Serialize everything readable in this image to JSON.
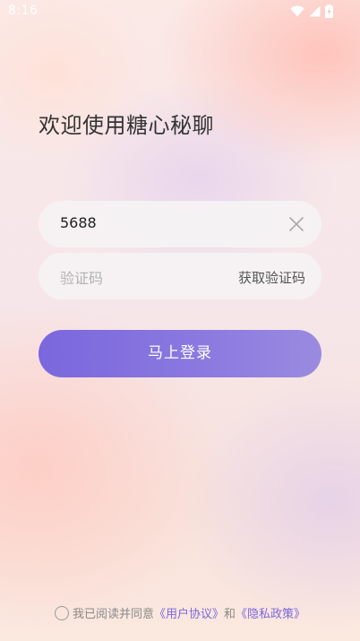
{
  "status_bar": {
    "time": "8:16",
    "icons": [
      "wifi-icon",
      "signal-icon",
      "battery-icon"
    ]
  },
  "welcome": {
    "title": "欢迎使用糖心秘聊"
  },
  "phone_field": {
    "value": "5688",
    "clear_icon": "close-icon"
  },
  "code_field": {
    "placeholder": "验证码",
    "get_code_label": "获取验证码"
  },
  "login_button": {
    "label": "马上登录"
  },
  "agreement": {
    "checked": false,
    "prefix": "我已阅读并同意",
    "user_agreement": "《用户协议》",
    "conjunction": "和",
    "privacy_policy": "《隐私政策》"
  },
  "colors": {
    "accent": "#7a67dd",
    "title_text": "#333333",
    "placeholder_text": "#b2b2b2",
    "field_background": "#f5f3f4"
  }
}
